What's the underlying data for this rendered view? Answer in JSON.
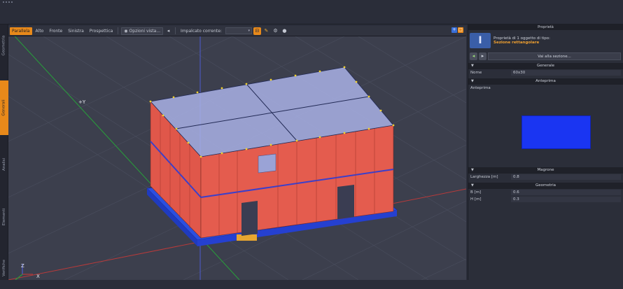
{
  "toolbar": {
    "view_tabs": [
      "Parallela",
      "Alto",
      "Fronte",
      "Sinistra",
      "Prospettica"
    ],
    "options_label": "Opzioni vista...",
    "stack_label": "Impalcato corrente:"
  },
  "left_tabs": [
    "Geometria",
    "Generali",
    "Analisi",
    "Elementi",
    "Verifiche"
  ],
  "viewport": {
    "axis_y_label": "+Y",
    "triad_z": "Z",
    "triad_x": "X"
  },
  "panel": {
    "title": "Proprietà",
    "header_line1": "Proprietà di 1 oggetto di tipo:",
    "header_line2": "Sezione rettangolare",
    "goto_button": "Vai alla sezione...",
    "icon_glyph": "I",
    "sections": {
      "general": "Generale",
      "preview": "Anteprima",
      "magrone": "Magrone",
      "geometry": "Geometria"
    },
    "rows": {
      "name_key": "Nome",
      "name_val": "60x30",
      "preview_label": "Anteprima",
      "width_key": "Larghezza [m]",
      "width_val": "0.8",
      "b_key": "B [m]",
      "b_val": "0.6",
      "h_key": "H [m]",
      "h_val": "0.3"
    }
  },
  "colors": {
    "accent": "#e8891a",
    "wall": "#e0574a",
    "foundation": "#2b4fe0",
    "glass": "#a9b2e6"
  }
}
